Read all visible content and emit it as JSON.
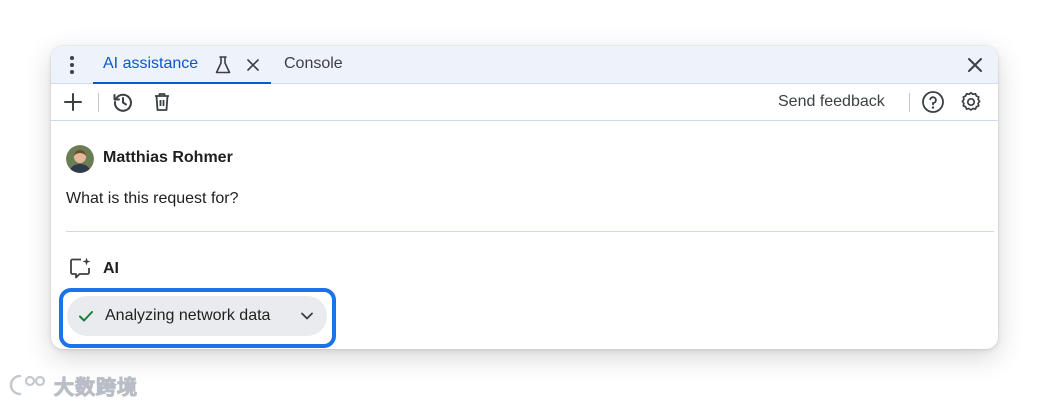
{
  "tabs": [
    {
      "label": "AI assistance",
      "active": true,
      "experimental_icon": "flask-icon",
      "closable": true
    },
    {
      "label": "Console",
      "active": false
    }
  ],
  "toolbar": {
    "new_chat_icon": "plus-icon",
    "history_icon": "history-icon",
    "delete_icon": "trash-icon",
    "feedback_label": "Send feedback",
    "help_icon": "help-circle-icon",
    "settings_icon": "gear-icon"
  },
  "conversation": {
    "user": {
      "name": "Matthias Rohmer",
      "message": "What is this request for?"
    },
    "assistant": {
      "name": "AI",
      "steps": [
        {
          "label": "Analyzing network data",
          "status": "done",
          "status_icon": "check-icon",
          "expand_icon": "chevron-down-icon"
        }
      ]
    }
  },
  "watermark": {
    "text": "大数跨境"
  },
  "colors": {
    "accent": "#0b57d0",
    "tabbar_bg": "#eef2fa",
    "chip_bg": "#e9ebee",
    "check": "#188038",
    "highlight": "#1a73e8"
  }
}
